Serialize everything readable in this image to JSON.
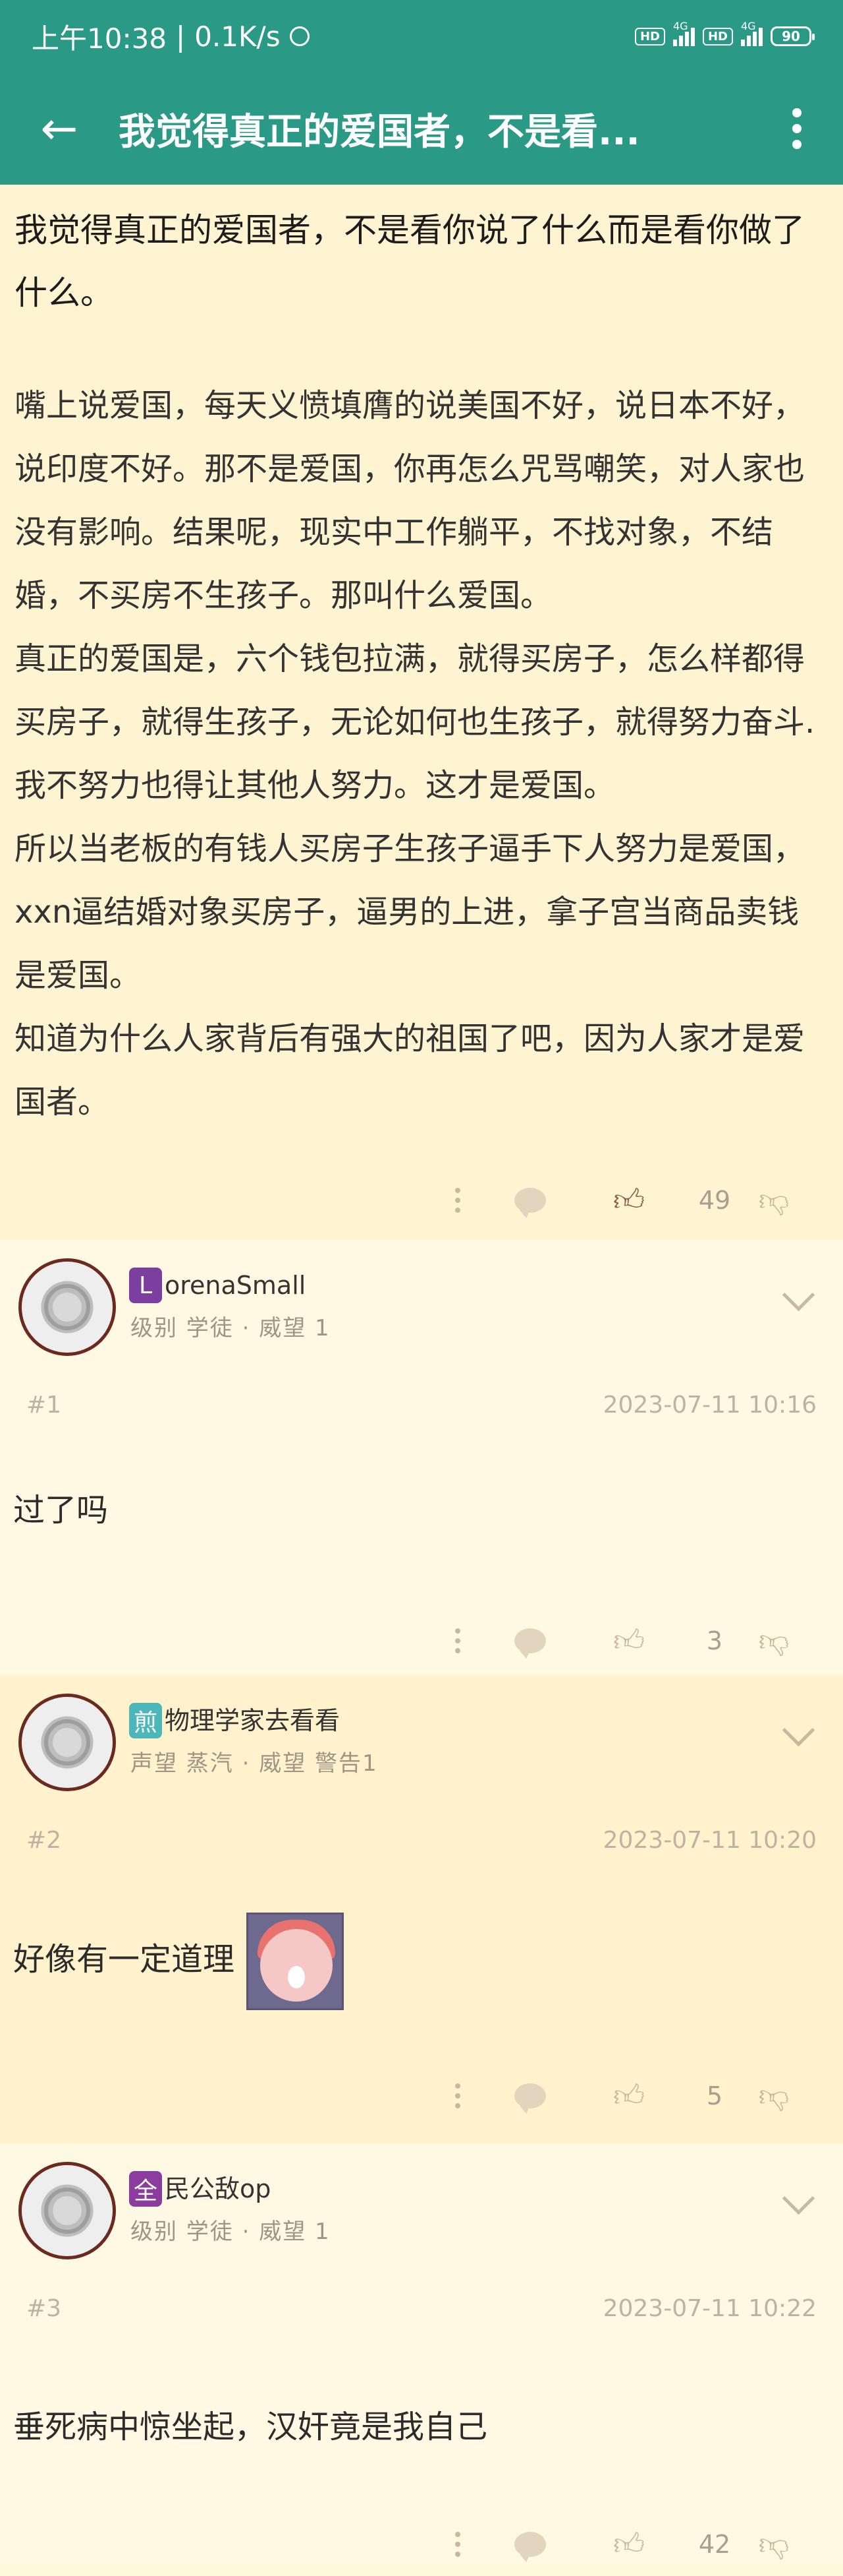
{
  "status_bar": {
    "time": "上午10:38",
    "speed": "0.1K/s",
    "hd1": "HD",
    "net1": "4G",
    "hd2": "HD",
    "net2": "4G",
    "battery": "90"
  },
  "app_bar": {
    "title": "我觉得真正的爱国者，不是看..."
  },
  "original_post": {
    "title": "我觉得真正的爱国者，不是看你说了什么而是看你做了什么。",
    "paragraphs": [
      "嘴上说爱国，每天义愤填膺的说美国不好，说日本不好，说印度不好。那不是爱国，你再怎么咒骂嘲笑，对人家也没有影响。结果呢，现实中工作躺平，不找对象，不结婚，不买房不生孩子。那叫什么爱国。",
      "真正的爱国是，六个钱包拉满，就得买房子，怎么样都得买房子，就得生孩子，无论如何也生孩子，就得努力奋斗.我不努力也得让其他人努力。这才是爱国。",
      "所以当老板的有钱人买房子生孩子逼手下人努力是爱国，xxn逼结婚对象买房子，逼男的上进，拿子宫当商品卖钱是爱国。",
      "知道为什么人家背后有强大的祖国了吧，因为人家才是爱国者。"
    ],
    "likes": "49"
  },
  "replies": [
    {
      "badge": "L",
      "badge_color": "#7b3fa0",
      "username": "orenaSmall",
      "meta": "级别 学徒 · 威望 1",
      "floor": "#1",
      "time": "2023-07-11 10:16",
      "content": "过了吗",
      "likes": "3"
    },
    {
      "badge": "煎",
      "badge_color": "#4cb6b8",
      "username": "物理学家去看看",
      "meta": "声望 蒸汽 · 威望 警告1",
      "floor": "#2",
      "time": "2023-07-11 10:20",
      "content": "好像有一定道理",
      "likes": "5"
    },
    {
      "badge": "全",
      "badge_color": "#8a3d9e",
      "username": "民公敌op",
      "meta": "级别 学徒 · 威望 1",
      "floor": "#3",
      "time": "2023-07-11 10:22",
      "content": "垂死病中惊坐起，汉奸竟是我自己",
      "likes": "42"
    }
  ],
  "icons": [
    "back-arrow-icon",
    "more-vert-icon",
    "comment-icon",
    "thumb-up-icon",
    "thumb-down-icon",
    "expand-chevron-icon"
  ]
}
